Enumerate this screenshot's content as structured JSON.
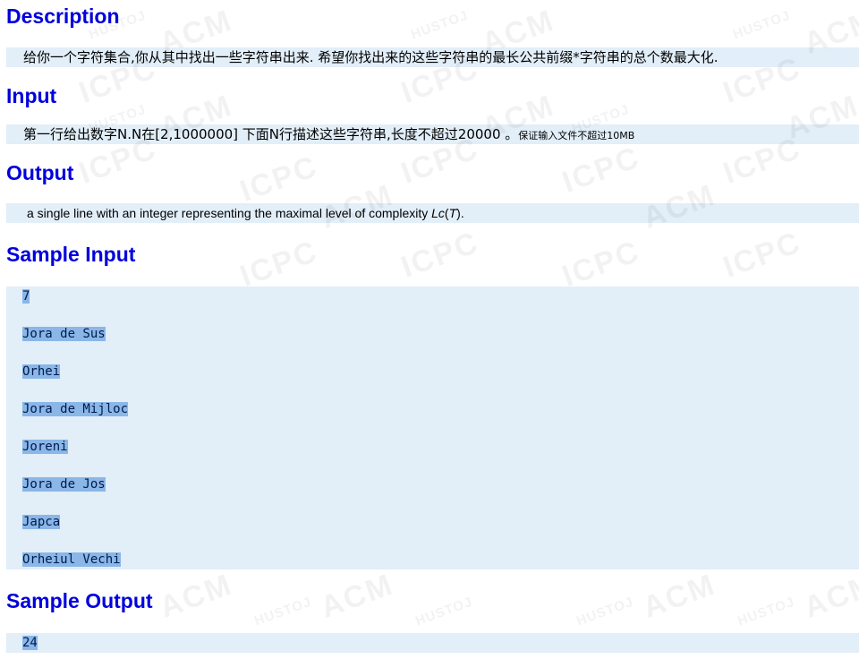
{
  "description": {
    "title": "Description",
    "text": "给你一个字符集合,你从其中找出一些字符串出来. 希望你找出来的这些字符串的最长公共前缀*字符串的总个数最大化."
  },
  "input": {
    "title": "Input",
    "text": "第一行给出数字N.N在[2,1000000] 下面N行描述这些字符串,长度不超过20000 。",
    "note": "保证输入文件不超过10MB"
  },
  "output": {
    "title": "Output",
    "text_before": "a single line with an integer representing the maximal level of complexity ",
    "text_italic1": "Lc",
    "text_paren_open": "(",
    "text_italic2": "T",
    "text_after": ")."
  },
  "sample_input": {
    "title": "Sample Input",
    "lines": [
      "7",
      "Jora de Sus",
      "Orhei",
      "Jora de Mijloc",
      "Joreni",
      "Jora de Jos",
      "Japca",
      "Orheiul Vechi"
    ]
  },
  "sample_output": {
    "title": "Sample Output",
    "lines": [
      "24"
    ]
  },
  "watermark": {
    "word1": "ACM",
    "word2": "ICPC",
    "word3": "HUSTOJ"
  },
  "colors": {
    "title": "#0000dd",
    "panel": "#e2eef8",
    "selection": "#8ab6e8"
  }
}
